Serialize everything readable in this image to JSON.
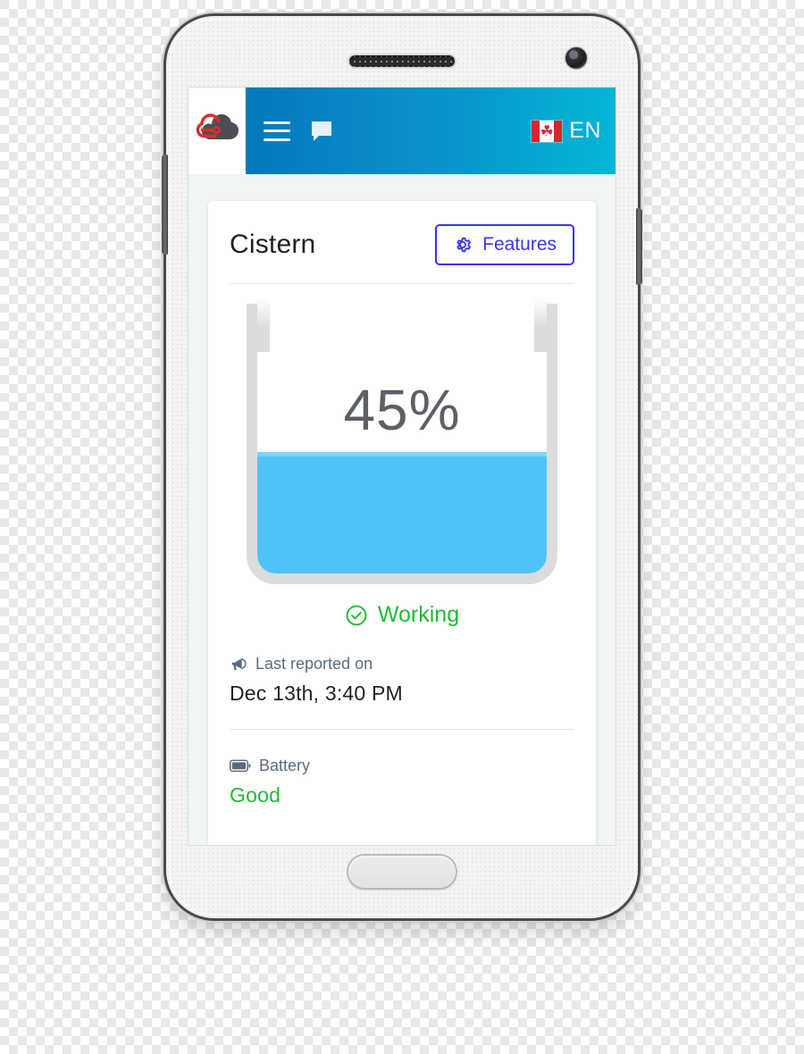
{
  "app": {
    "header": {
      "logo_name": "cloud-logo",
      "menu_label": "menu",
      "chat_label": "messages",
      "language_code": "EN",
      "flag_country": "Canada",
      "flag_leaf": "☘"
    },
    "card": {
      "title": "Cistern",
      "features_button": "Features",
      "gauge": {
        "percent_label": "45%",
        "fill_percent": 45,
        "water_color": "#4fc3f7",
        "tank_color": "#dcdcdc"
      },
      "status": {
        "icon": "check-circle-icon",
        "text": "Working",
        "color": "#22bb33"
      },
      "last_reported": {
        "icon": "megaphone-icon",
        "label": "Last reported on",
        "value": "Dec 13th, 3:40 PM"
      },
      "battery": {
        "icon": "battery-icon",
        "label": "Battery",
        "value": "Good",
        "color": "#22bb33"
      }
    }
  },
  "theme": {
    "header_gradient_start": "#0378bd",
    "header_gradient_end": "#04b6d6",
    "accent_button": "#3a33ef",
    "screen_background": "#eef5f4",
    "card_background": "#ffffff"
  }
}
